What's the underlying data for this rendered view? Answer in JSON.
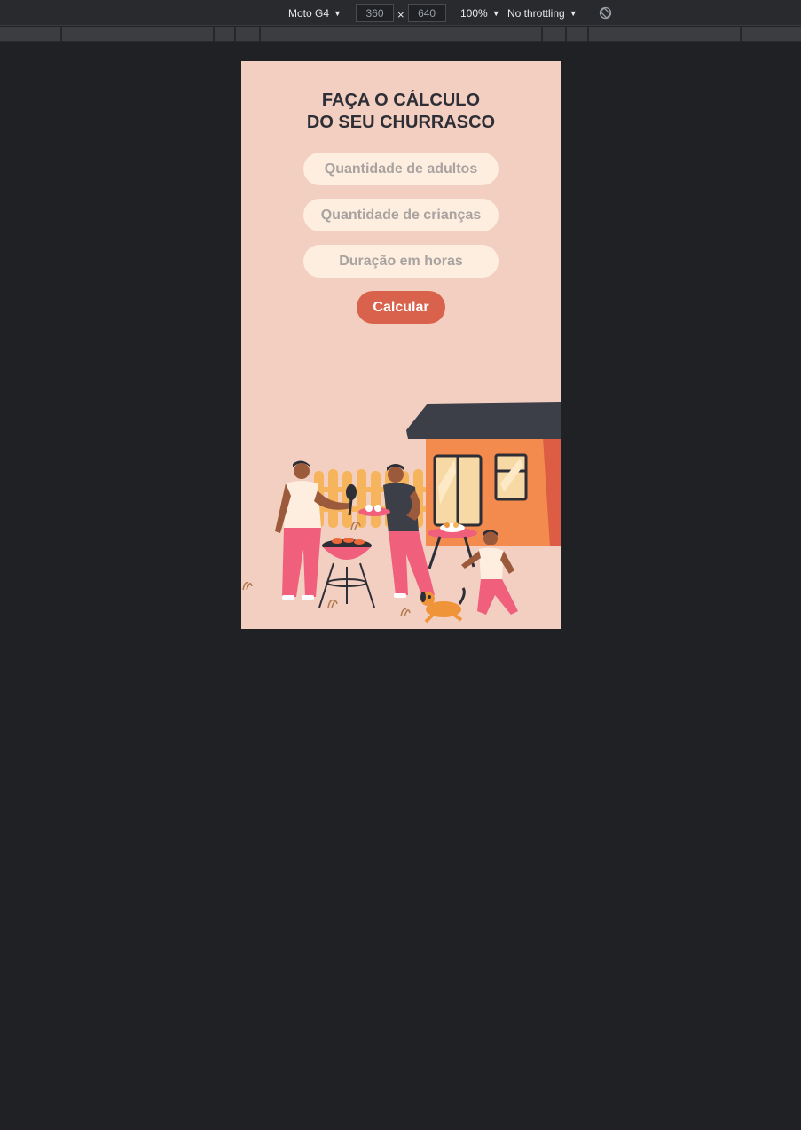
{
  "devtools": {
    "device": "Moto G4",
    "width": "360",
    "height": "640",
    "separator": "×",
    "zoom": "100%",
    "throttling": "No throttling",
    "rotate_icon": "rotate-icon"
  },
  "app": {
    "title_line1": "FAÇA O CÁLCULO",
    "title_line2": "DO SEU CHURRASCO",
    "adults_placeholder": "Quantidade de adultos",
    "children_placeholder": "Quantidade de crianças",
    "duration_placeholder": "Duração em horas",
    "calculate_label": "Calcular",
    "illustration": "barbecue-party-illustration"
  },
  "colors": {
    "page_bg": "#202124",
    "phone_bg": "#f2cfc0",
    "field_bg": "#fdeee0",
    "button_bg": "#d9624d",
    "title_color": "#2e2e36"
  }
}
